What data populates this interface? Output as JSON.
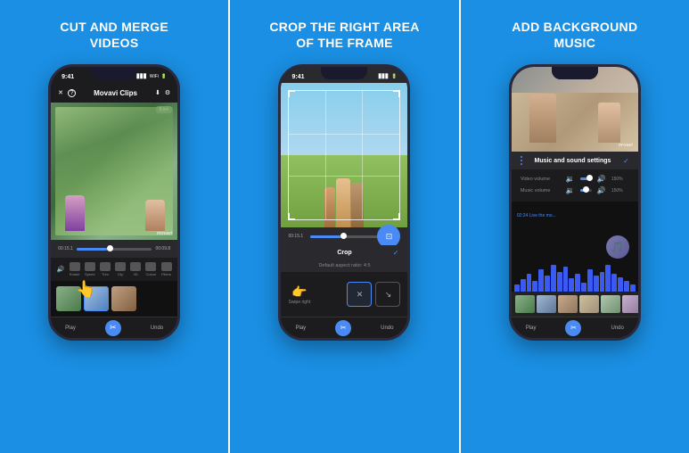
{
  "panels": [
    {
      "id": "panel-cut",
      "title": "CUT AND MERGE\nVIDEOS",
      "phone": {
        "statusbar": {
          "time": "9:41"
        },
        "titlebar": {
          "app_name": "Movavi Clips"
        },
        "video": {
          "brand": "movavi",
          "overlay": "lLive"
        },
        "timeline": {
          "time_left": "00:15.1",
          "time_right": "00:09.8"
        },
        "tools": [
          {
            "label": "Audio"
          },
          {
            "label": "Rotate"
          },
          {
            "label": "Speed"
          },
          {
            "label": "Trim"
          },
          {
            "label": "Clip"
          },
          {
            "label": "3D"
          },
          {
            "label": "Colour"
          },
          {
            "label": "Filters"
          }
        ],
        "bottom_nav": {
          "play": "Play",
          "undo": "Undo"
        }
      }
    },
    {
      "id": "panel-crop",
      "title": "CROP THE RIGHT AREA\nOF THE FRAME",
      "phone": {
        "statusbar": {
          "time": "9:41"
        },
        "crop_label": "Crop",
        "check": "✓",
        "aspect_label": "Default aspect ratio: 4:5",
        "swipe_label": "Swipe right",
        "ratio_options": [
          {
            "id": "custom",
            "icon": "✕",
            "selected": true
          },
          {
            "id": "diagonal",
            "icon": "↘",
            "selected": false
          }
        ],
        "timeline": {
          "time_left": "00:15.1"
        },
        "bottom_nav": {
          "play": "Play",
          "undo": "Undo"
        }
      }
    },
    {
      "id": "panel-music",
      "title": "ADD BACKGROUND\nMUSIC",
      "phone": {
        "video": {
          "brand": "m•vavi"
        },
        "settings": {
          "title": "Music and sound settings",
          "check": "✓",
          "video_volume_label": "Video volume",
          "video_volume_pct": "150%",
          "music_volume_label": "Music volume",
          "music_volume_pct": "150%"
        },
        "music_track": "02:24 Live the mo...",
        "bottom_nav": {
          "play": "Play",
          "undo": "Undo"
        }
      }
    }
  ]
}
